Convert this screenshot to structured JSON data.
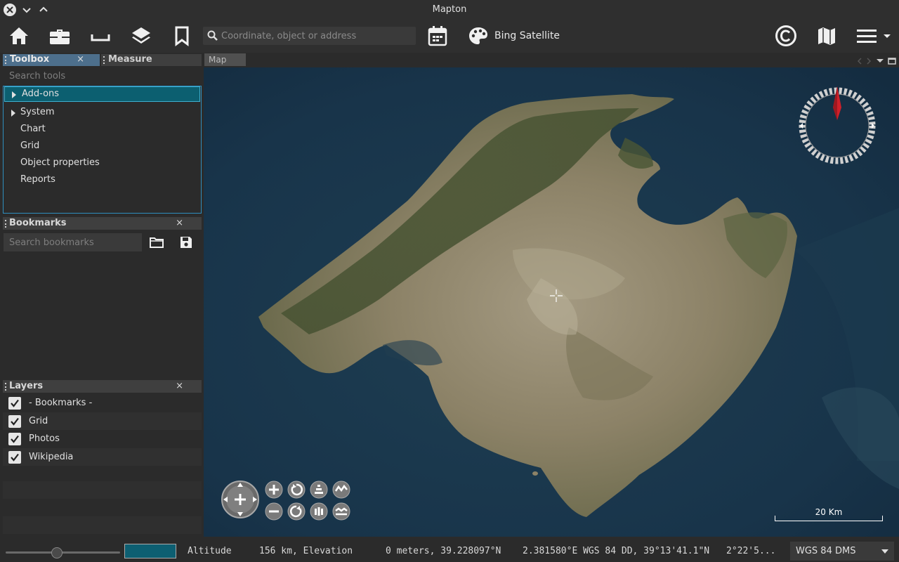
{
  "window": {
    "title": "Mapton"
  },
  "toolbar": {
    "search_placeholder": "Coordinate, object or address",
    "basemap_label": "Bing Satellite",
    "icons": [
      "home-icon",
      "toolbox-icon",
      "ruler-icon",
      "layers-icon",
      "bookmark-icon",
      "calendar-icon",
      "palette-icon",
      "copyright-icon",
      "map-icon",
      "menu-icon"
    ]
  },
  "left_tabs": {
    "toolbox": "Toolbox",
    "measure": "Measure",
    "close": "×"
  },
  "toolbox": {
    "search_placeholder": "Search tools",
    "items": [
      {
        "label": "Add-ons",
        "expandable": true,
        "selected": true
      },
      {
        "label": "System",
        "expandable": true,
        "selected": false
      },
      {
        "label": "Chart",
        "expandable": false
      },
      {
        "label": "Grid",
        "expandable": false
      },
      {
        "label": "Object properties",
        "expandable": false
      },
      {
        "label": "Reports",
        "expandable": false
      }
    ]
  },
  "bookmarks": {
    "title": "Bookmarks",
    "close": "×",
    "search_placeholder": "Search bookmarks"
  },
  "layers": {
    "title": "Layers",
    "close": "×",
    "items": [
      {
        "label": "- Bookmarks -",
        "checked": true
      },
      {
        "label": "Grid",
        "checked": true
      },
      {
        "label": "Photos",
        "checked": true
      },
      {
        "label": "Wikipedia",
        "checked": true
      }
    ]
  },
  "map": {
    "tab_label": "Map",
    "scale_label": "20 Km"
  },
  "status": {
    "altitude_label": "Altitude",
    "altitude_value": "156 km, Elevation",
    "elevation_value": "0 meters, 39.228097°N",
    "coords": "2.381580°E WGS 84 DD, 39°13'41.1\"N",
    "coords_trunc": "2°22'5...",
    "crs": "WGS 84 DMS",
    "slider_value": 0.45,
    "color_swatch": "#0d5f72"
  }
}
